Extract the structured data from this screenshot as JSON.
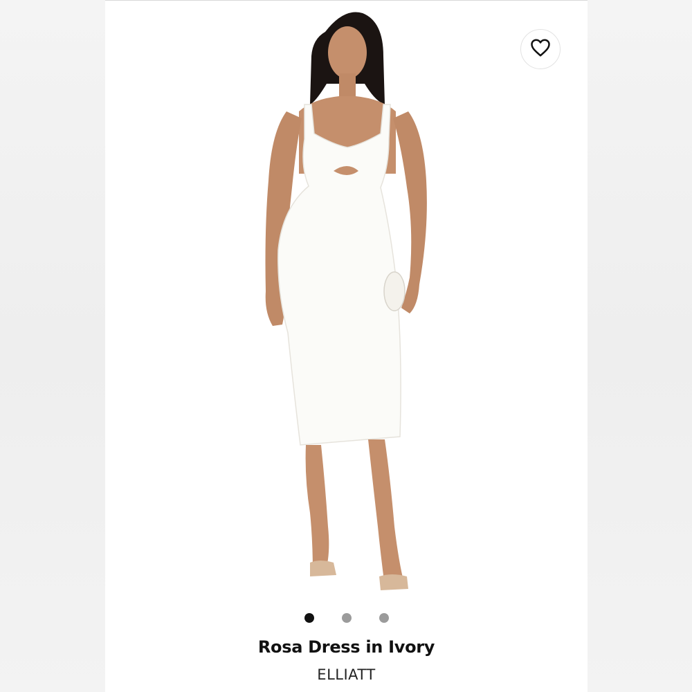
{
  "product": {
    "title": "Rosa Dress in Ivory",
    "brand": "ELLIATT",
    "favorite_icon": "heart-outline-icon",
    "carousel": {
      "total_images": 3,
      "active_index": 0
    }
  },
  "colors": {
    "dress": "#fbfbf8",
    "active_dot": "#111111",
    "inactive_dot": "#9b9b9b",
    "background": "#ffffff"
  }
}
